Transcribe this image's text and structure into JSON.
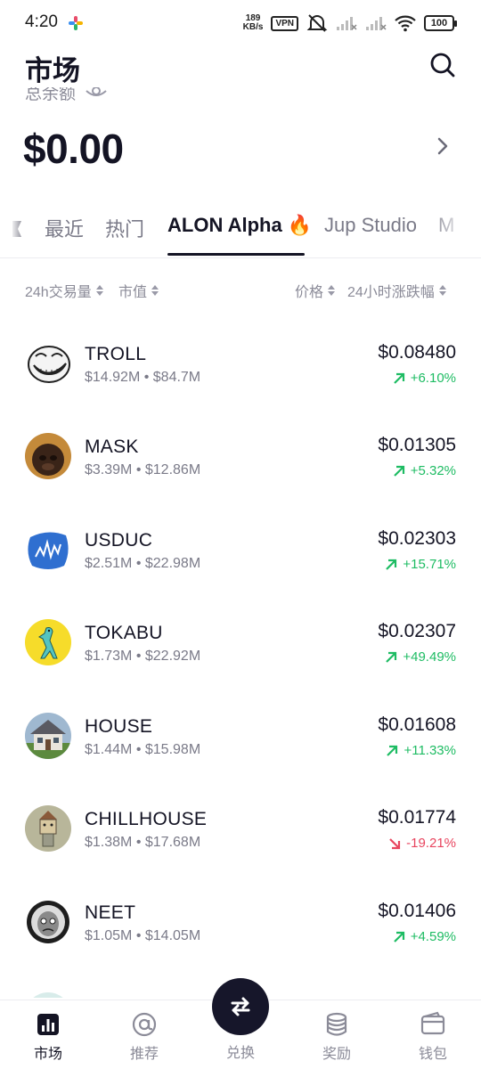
{
  "status_bar": {
    "time": "4:20",
    "net_speed_value": "189",
    "net_speed_unit": "KB/s",
    "vpn": "VPN",
    "battery": "100"
  },
  "header": {
    "title": "市场",
    "search_icon": "search-icon"
  },
  "balance": {
    "label": "总余额",
    "amount": "$0.00"
  },
  "tabs": [
    {
      "label": "最近"
    },
    {
      "label": "热门"
    },
    {
      "label": "ALON Alpha 🔥",
      "active": true
    },
    {
      "label": "Jup Studio"
    },
    {
      "label": "M"
    }
  ],
  "sort": {
    "volume": "24h交易量",
    "market_cap": "市值",
    "price": "价格",
    "change": "24小时涨跌幅"
  },
  "tokens": [
    {
      "symbol": "TROLL",
      "volume": "$14.92M",
      "market_cap": "$84.7M",
      "price": "$0.08480",
      "change": "+6.10%",
      "direction": "up"
    },
    {
      "symbol": "MASK",
      "volume": "$3.39M",
      "market_cap": "$12.86M",
      "price": "$0.01305",
      "change": "+5.32%",
      "direction": "up"
    },
    {
      "symbol": "USDUC",
      "volume": "$2.51M",
      "market_cap": "$22.98M",
      "price": "$0.02303",
      "change": "+15.71%",
      "direction": "up"
    },
    {
      "symbol": "TOKABU",
      "volume": "$1.73M",
      "market_cap": "$22.92M",
      "price": "$0.02307",
      "change": "+49.49%",
      "direction": "up"
    },
    {
      "symbol": "HOUSE",
      "volume": "$1.44M",
      "market_cap": "$15.98M",
      "price": "$0.01608",
      "change": "+11.33%",
      "direction": "up"
    },
    {
      "symbol": "CHILLHOUSE",
      "volume": "$1.38M",
      "market_cap": "$17.68M",
      "price": "$0.01774",
      "change": "-19.21%",
      "direction": "down"
    },
    {
      "symbol": "NEET",
      "volume": "$1.05M",
      "market_cap": "$14.05M",
      "price": "$0.01406",
      "change": "+4.59%",
      "direction": "up"
    }
  ],
  "bottom_nav": {
    "market": "市场",
    "recommend": "推荐",
    "swap": "兑换",
    "rewards": "奖励",
    "wallet": "钱包"
  },
  "colors": {
    "primary": "#141424",
    "muted": "#8b8b98",
    "positive": "#1ebc63",
    "negative": "#e8455f",
    "fab": "#16162a"
  }
}
